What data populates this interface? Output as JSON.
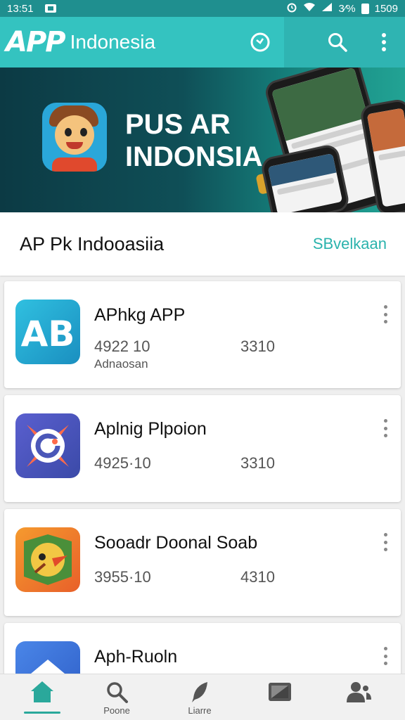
{
  "status_bar": {
    "time": "13:51",
    "battery_text": "3⁄%",
    "clock_right": "1509"
  },
  "app_bar": {
    "logo_mark": "APP",
    "title": "Indonesia",
    "icons": [
      "refresh-icon",
      "search-icon",
      "more-vert-icon"
    ]
  },
  "banner": {
    "title_line1": "PUS AR",
    "title_line2": "INDONSIA"
  },
  "section": {
    "title": "AP Pk Indooasiia",
    "action": "SBvelkaan"
  },
  "apps": [
    {
      "name": "APhkg APP",
      "value1": "4922 10",
      "value2": "3310",
      "sub": "Adnaosan",
      "icon": "ab-app-icon",
      "color": "#1fa8d0"
    },
    {
      "name": "Aplnig Plpoion",
      "value1": "4925·10",
      "value2": "3310",
      "sub": "",
      "icon": "c-app-icon",
      "color": "#4b57b8"
    },
    {
      "name": "Sooadr Doonal Soab",
      "value1": "3955·10",
      "value2": "4310",
      "sub": "",
      "icon": "parrot-app-icon",
      "color": "#ef7a24"
    },
    {
      "name": "Aph-Ruoln",
      "value1": "",
      "value2": "",
      "sub": "",
      "icon": "house-app-icon",
      "color": "#3d6fd6"
    }
  ],
  "bottom_nav": {
    "items": [
      {
        "icon": "home-icon",
        "label": ""
      },
      {
        "icon": "search-icon",
        "label": "Poone"
      },
      {
        "icon": "feather-icon",
        "label": "Liarre"
      },
      {
        "icon": "tv-icon",
        "label": ""
      },
      {
        "icon": "people-icon",
        "label": ""
      }
    ],
    "active_color": "#2aa89b"
  },
  "colors": {
    "app_bar": "#34c3c0",
    "status_bar": "#1f8f8f",
    "accent": "#2bb3ad"
  }
}
